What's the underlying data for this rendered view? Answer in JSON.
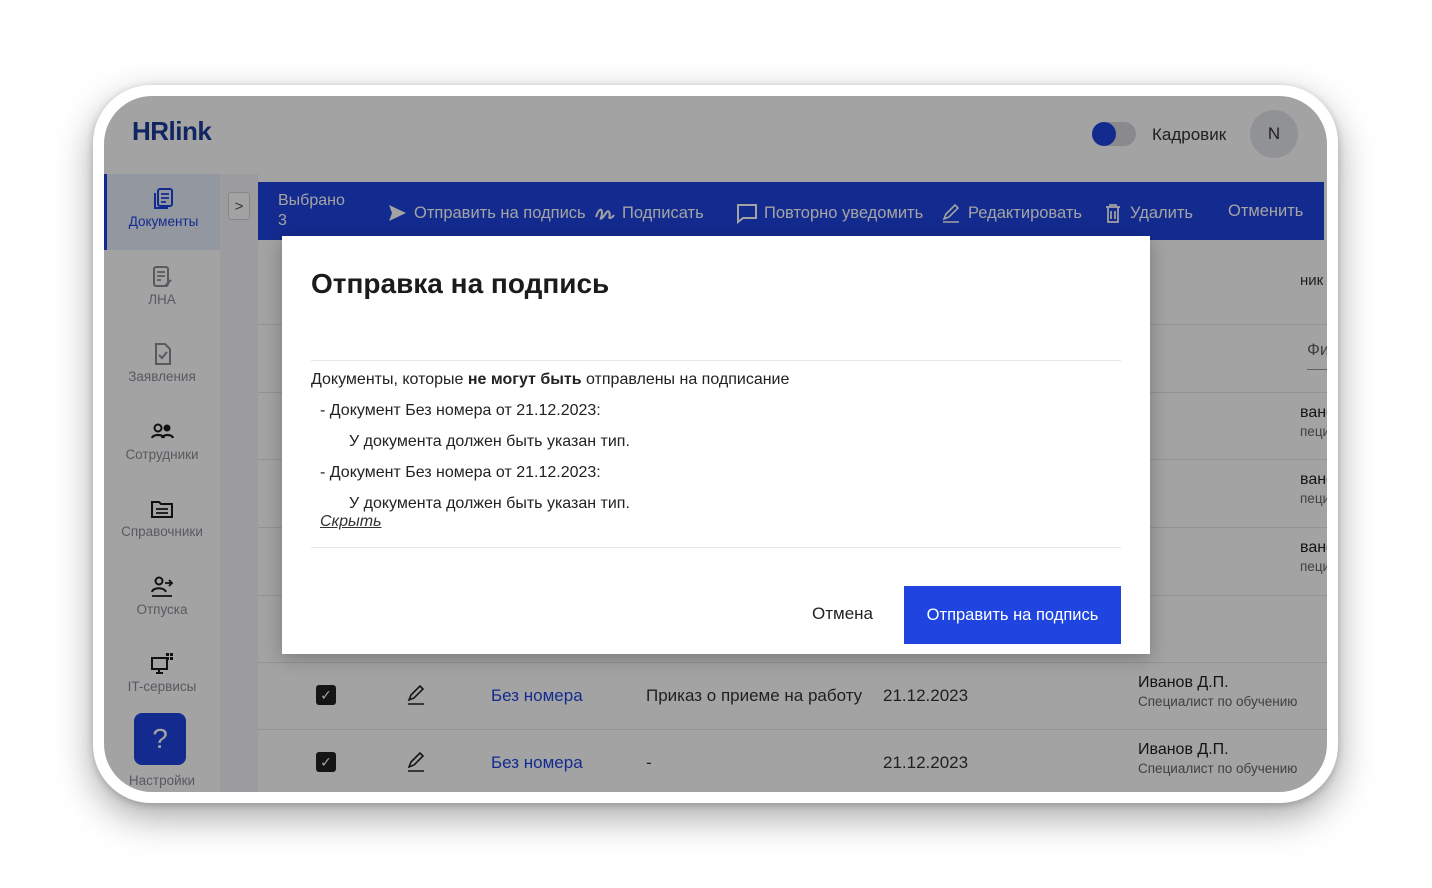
{
  "header": {
    "logo": "HRlink",
    "role_label": "Кадровик",
    "avatar_initial": "N"
  },
  "sidebar": {
    "items": [
      {
        "label": "Документы",
        "icon": "documents-icon",
        "active": true
      },
      {
        "label": "ЛНА",
        "icon": "lna-icon",
        "active": false
      },
      {
        "label": "Заявления",
        "icon": "applications-icon",
        "active": false
      },
      {
        "label": "Сотрудники",
        "icon": "employees-icon",
        "active": false
      },
      {
        "label": "Справочники",
        "icon": "directories-icon",
        "active": false
      },
      {
        "label": "Отпуска",
        "icon": "vacations-icon",
        "active": false
      },
      {
        "label": "IT-сервисы",
        "icon": "it-services-icon",
        "active": false
      },
      {
        "label": "Настройки",
        "icon": "settings-icon",
        "active": false
      }
    ],
    "help_label": "?"
  },
  "expander_label": ">",
  "actionbar": {
    "selected_label": "Выбрано",
    "selected_count": "3",
    "send_label": "Отправить на подпись",
    "sign_label": "Подписать",
    "renotify_label": "Повторно уведомить",
    "edit_label": "Редактировать",
    "delete_label": "Удалить",
    "cancel_label": "Отменить"
  },
  "table": {
    "employee_header": "ник",
    "filter_placeholder": "Фильтр",
    "background_rows": [
      {
        "name": "ванов Д.П.",
        "position": "пециалист по обучению"
      },
      {
        "name": "ванов Д.П.",
        "position": "пециалист по обучению"
      },
      {
        "name": "ванов Д.П.",
        "position": "пециалист по обучению"
      }
    ],
    "rows": [
      {
        "number": "Без номера",
        "type": "Приказ о приеме на работу",
        "date": "21.12.2023",
        "employee": "Иванов Д.П.",
        "position": "Специалист по обучению"
      },
      {
        "number": "Без номера",
        "type": "-",
        "date": "21.12.2023",
        "employee": "Иванов Д.П.",
        "position": "Специалист по обучению"
      }
    ]
  },
  "modal": {
    "title": "Отправка на подпись",
    "intro_prefix": "Документы, которые ",
    "intro_bold": "не могут быть",
    "intro_suffix": " отправлены на подписание",
    "issues": [
      {
        "document": "- Документ Без номера от 21.12.2023:",
        "reason": "У документа должен быть указан тип."
      },
      {
        "document": "- Документ Без номера от 21.12.2023:",
        "reason": "У документа должен быть указан тип."
      }
    ],
    "hide_link": "Скрыть",
    "cancel_button": "Отмена",
    "submit_button": "Отправить на подпись"
  }
}
